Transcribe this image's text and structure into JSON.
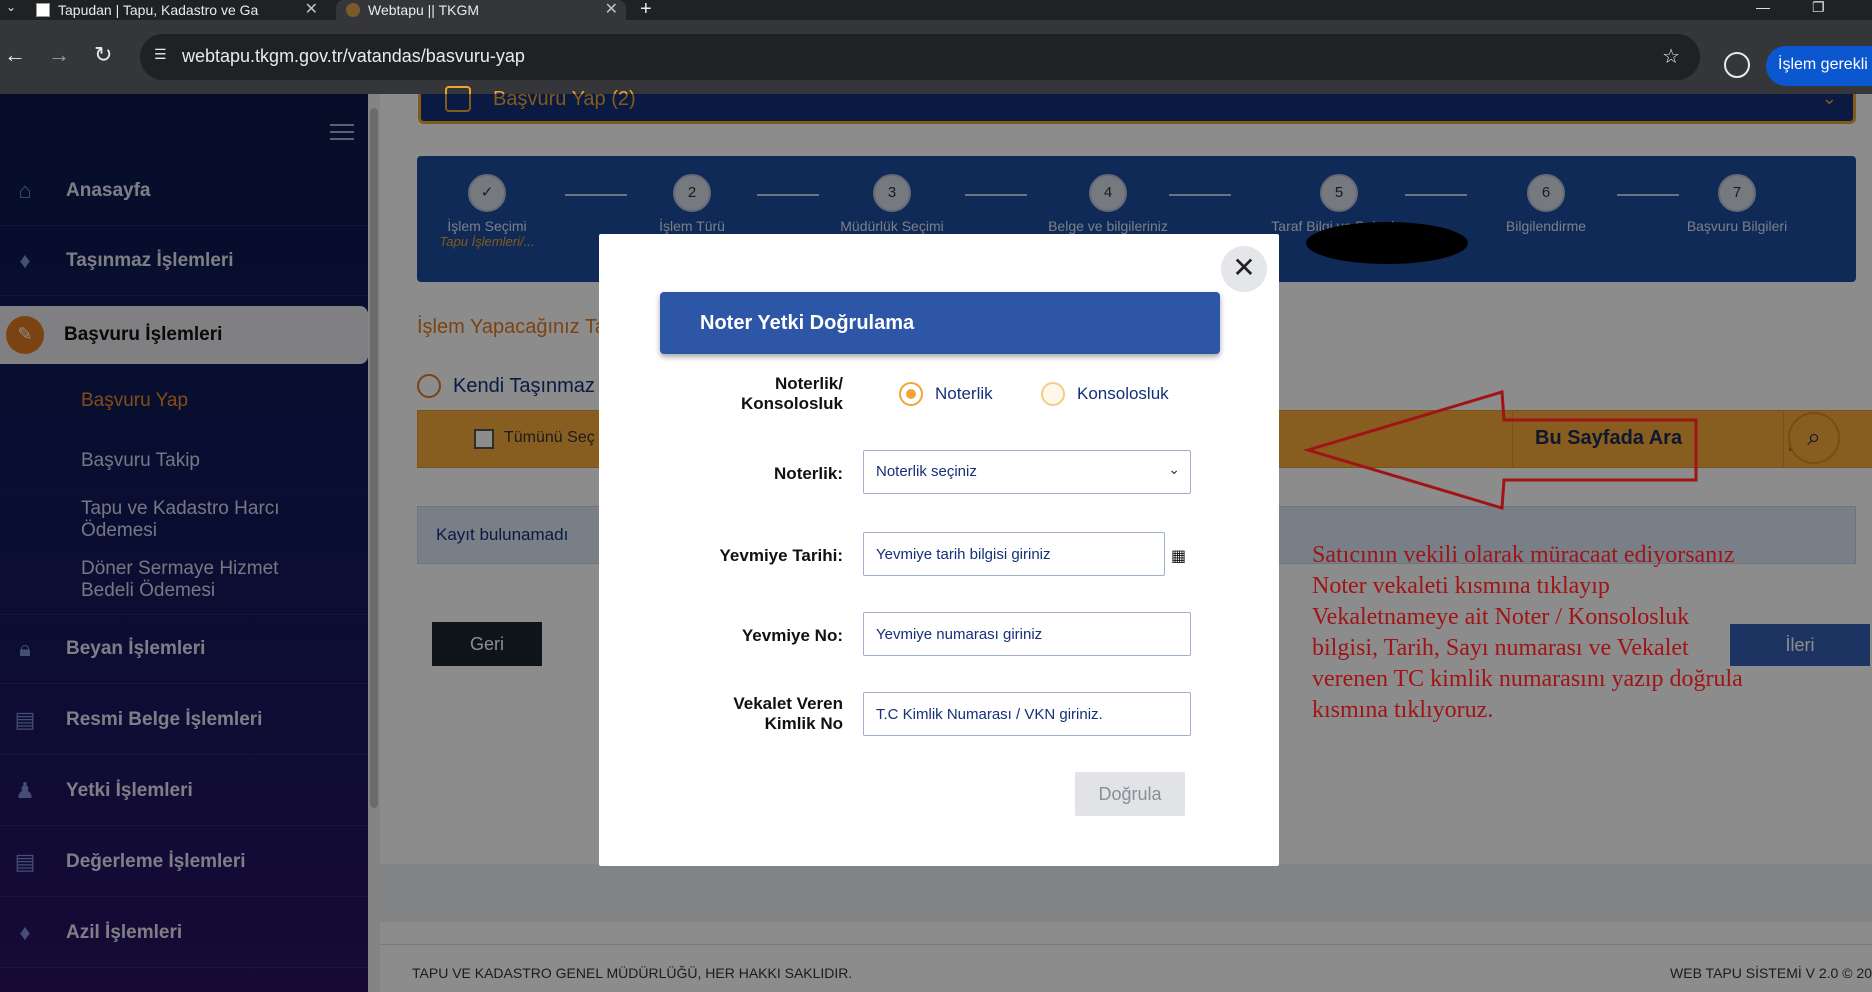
{
  "browser": {
    "tabs": [
      {
        "title": "Tapudan | Tapu, Kadastro ve Ga",
        "close": "✕"
      },
      {
        "title": "Webtapu || TKGM",
        "close": "✕"
      }
    ],
    "new_tab": "+",
    "url": "webtapu.tkgm.gov.tr/vatandas/basvuru-yap",
    "action_label": "İşlem gerekli"
  },
  "sidebar": {
    "items": [
      {
        "label": "Anasayfa",
        "icon": "home-icon"
      },
      {
        "label": "Taşınmaz İşlemleri",
        "icon": "location-pin-icon"
      },
      {
        "label": "Başvuru İşlemleri",
        "icon": "pen-icon"
      },
      {
        "label": "Beyan İşlemleri",
        "icon": "lock-icon"
      },
      {
        "label": "Resmi Belge İşlemleri",
        "icon": "document-icon"
      },
      {
        "label": "Yetki İşlemleri",
        "icon": "stamp-icon"
      },
      {
        "label": "Değerleme İşlemleri",
        "icon": "document-icon"
      },
      {
        "label": "Azil İşlemleri",
        "icon": "location-pin-icon"
      }
    ],
    "sub_items": [
      "Başvuru Yap",
      "Başvuru Takip",
      "Tapu ve Kadastro Harcı Ödemesi",
      "Döner Sermaye Hizmet Bedeli Ödemesi"
    ]
  },
  "main": {
    "banner_title": "Başvuru Yap (2)",
    "steps": [
      {
        "num": "✓",
        "label": "İşlem Seçimi",
        "sub": "Tapu İşlemleri/..."
      },
      {
        "num": "2",
        "label": "İşlem Türü",
        "sub": ""
      },
      {
        "num": "3",
        "label": "Müdürlük Seçimi",
        "sub": ""
      },
      {
        "num": "4",
        "label": "Belge ve bilgileriniz",
        "sub": ""
      },
      {
        "num": "5",
        "label": "Taraf Bilgi ve Belgeler",
        "sub": ""
      },
      {
        "num": "6",
        "label": "Bilgilendirme",
        "sub": ""
      },
      {
        "num": "7",
        "label": "Başvuru Bilgileri",
        "sub": ""
      }
    ],
    "section_title": "İşlem Yapacağınız Ta",
    "radio_label": "Kendi Taşınmaz",
    "select_all": "Tümünü Seç",
    "search_label": "Bu Sayfada Ara",
    "no_record": "Kayıt bulunamadı",
    "back_label": "Geri",
    "next_label": "İleri",
    "footer_left": "TAPU VE KADASTRO GENEL MÜDÜRLÜĞÜ, HER HAKKI SAKLIDIR.",
    "footer_right": "WEB TAPU SİSTEMİ V 2.0 © 20"
  },
  "modal": {
    "title": "Noter Yetki Doğrulama",
    "close": "✕",
    "type_label_1": "Noterlik/",
    "type_label_2": "Konsolosluk",
    "options": [
      "Noterlik",
      "Konsolosluk"
    ],
    "selected_option": "Noterlik",
    "noterlik_label": "Noterlik:",
    "noterlik_placeholder": "Noterlik seçiniz",
    "date_label": "Yevmiye Tarihi:",
    "date_placeholder": "Yevmiye tarih bilgisi giriniz",
    "no_label": "Yevmiye No:",
    "no_placeholder": "Yevmiye numarası giriniz",
    "id_label_1": "Vekalet Veren",
    "id_label_2": "Kimlik No",
    "id_placeholder": "T.C Kimlik Numarası / VKN giriniz.",
    "submit_label": "Doğrula"
  },
  "annotation": {
    "lines": [
      "Satıcının vekili olarak müracaat ediyorsanız",
      "Noter vekaleti kısmına tıklayıp",
      "Vekaletnameye ait Noter / Konsolosluk",
      "bilgisi, Tarih, Sayı numarası ve Vekalet",
      "verenen TC kimlik numarasını yazıp doğrula",
      "kısmına tıklıyoruz."
    ],
    "color": "#a01416"
  }
}
